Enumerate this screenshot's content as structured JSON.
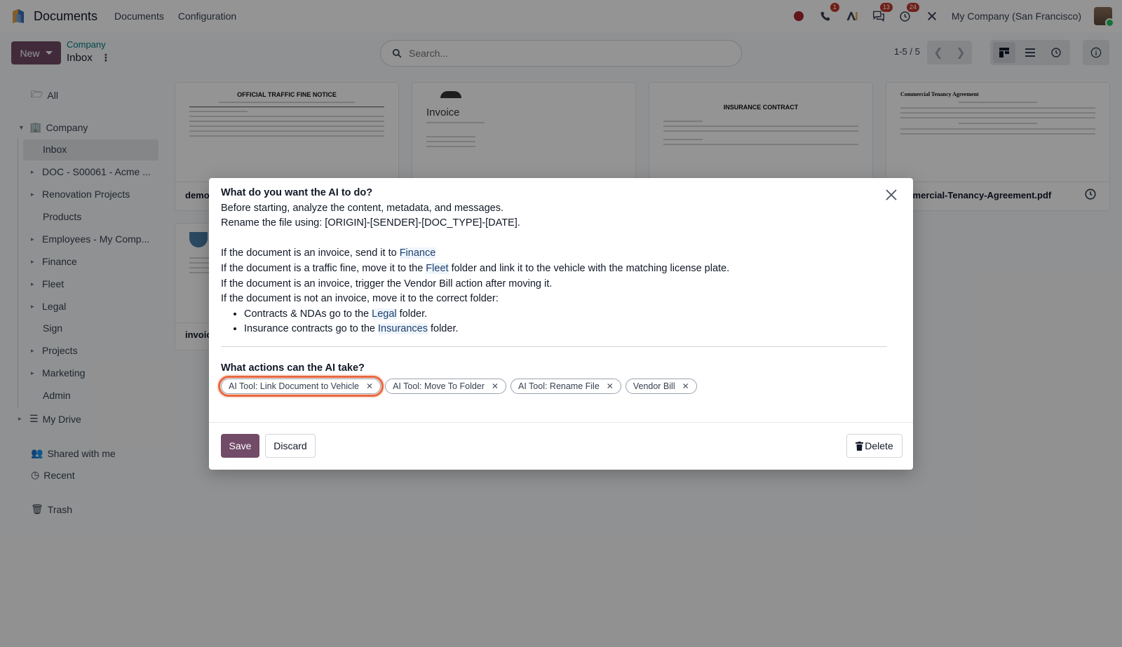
{
  "navbar": {
    "app_name": "Documents",
    "menus": [
      "Documents",
      "Configuration"
    ],
    "phone_badge": "1",
    "chat_badge": "13",
    "activity_badge": "24",
    "company": "My Company (San Francisco)"
  },
  "control_panel": {
    "new_label": "New",
    "breadcrumb_parent": "Company",
    "breadcrumb_current": "Inbox",
    "search_placeholder": "Search...",
    "pager": "1-5 / 5"
  },
  "sidebar": {
    "all": "All",
    "company": "Company",
    "inbox": "Inbox",
    "doc": "DOC - S00061 - Acme ...",
    "renovation": "Renovation Projects",
    "products": "Products",
    "employees": "Employees - My Comp...",
    "finance": "Finance",
    "fleet": "Fleet",
    "legal": "Legal",
    "sign": "Sign",
    "projects": "Projects",
    "marketing": "Marketing",
    "admin": "Admin",
    "my_drive": "My Drive",
    "shared": "Shared with me",
    "recent": "Recent",
    "trash": "Trash"
  },
  "cards": {
    "card1_title": "OFFICIAL TRAFFIC FINE NOTICE",
    "card1_name": "demo",
    "card2_title": "Invoice",
    "card3_title": "INSURANCE CONTRACT",
    "card4_title": "Commercial Tenancy Agreement",
    "card4_name": "mmercial-Tenancy-Agreement.pdf",
    "card5_name": "invoic"
  },
  "dialog": {
    "heading": "What do you want the AI to do?",
    "line1": "Before starting, analyze the content, metadata, and messages.",
    "line2": "Rename the file using: [ORIGIN]-[SENDER]-[DOC_TYPE]-[DATE].",
    "r1_pre": "If the document is an invoice, send it to ",
    "r1_link": "Finance",
    "r2_pre": "If the document is a traffic fine, move it to the ",
    "r2_link": "Fleet",
    "r2_post": " folder and link it to the vehicle with the matching license plate.",
    "r3": "If the document is an invoice, trigger the Vendor Bill action after moving it.",
    "r4": "If the document is not an invoice, move it to the correct folder:",
    "b1_pre": "Contracts & NDAs go to the ",
    "b1_link": "Legal",
    "b1_post": " folder.",
    "b2_pre": "Insurance contracts go to the ",
    "b2_link": "Insurances",
    "b2_post": " folder.",
    "actions_heading": "What actions can the AI take?",
    "tags": [
      "AI Tool: Link Document to Vehicle",
      "AI Tool: Move To Folder",
      "AI Tool: Rename File",
      "Vendor Bill"
    ],
    "save": "Save",
    "discard": "Discard",
    "delete": "Delete"
  },
  "colors": {
    "primary": "#714b67",
    "link": "#017e84",
    "focus_ring": "#e8673f"
  }
}
